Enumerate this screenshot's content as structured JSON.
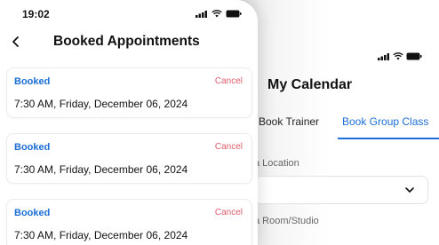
{
  "front": {
    "status_time": "19:02",
    "title": "Booked Appointments",
    "appointments": [
      {
        "status": "Booked",
        "action": "Cancel",
        "datetime": "7:30 AM, Friday, December 06, 2024"
      },
      {
        "status": "Booked",
        "action": "Cancel",
        "datetime": "7:30 AM, Friday, December 06, 2024"
      },
      {
        "status": "Booked",
        "action": "Cancel",
        "datetime": "7:30 AM, Friday, December 06, 2024"
      }
    ]
  },
  "back": {
    "title": "My Calendar",
    "tabs": [
      "Book Trainer",
      "Book Group Class"
    ],
    "active_tab": "Book Group Class",
    "location_label": "a Location",
    "room_label": "a Room/Studio"
  },
  "colors": {
    "accent": "#1d6fd6",
    "cancel": "#e25c6a",
    "text": "#111111"
  },
  "icons": [
    "back-chevron-icon",
    "signal-icon",
    "wifi-icon",
    "battery-icon",
    "chevron-down-icon"
  ]
}
